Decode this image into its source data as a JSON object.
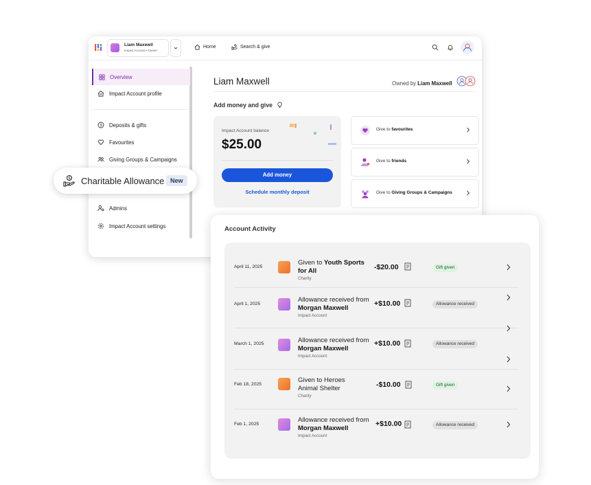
{
  "account": {
    "name": "Liam Maxwell",
    "subtitle": "Impact Account • Owner"
  },
  "nav": {
    "home": "Home",
    "search": "Search & give"
  },
  "sidebar": {
    "items": [
      {
        "label": "Overview",
        "icon": "grid-icon",
        "active": true
      },
      {
        "label": "Impact Account profile",
        "icon": "house-icon"
      },
      {
        "label": "Deposits & gifts",
        "icon": "dollar-circle-icon"
      },
      {
        "label": "Favourites",
        "icon": "heart-icon"
      },
      {
        "label": "Giving Groups & Campaigns",
        "icon": "people-icon"
      },
      {
        "label": "Admins",
        "icon": "person-gear-icon"
      },
      {
        "label": "Impact Account settings",
        "icon": "gear-icon"
      }
    ]
  },
  "main": {
    "title": "Liam Maxwell",
    "owned_prefix": "Owned by",
    "owned_name": "Liam Maxwell",
    "section_heading": "Add money and give",
    "balance_label": "Impact Account balance",
    "balance_value": "$25.00",
    "add_money": "Add money",
    "schedule": "Schedule monthly deposit",
    "give_prefix": "Give to",
    "give_favourites": "favourites",
    "give_friends": "friends",
    "give_groups": "Giving Groups & Campaigns"
  },
  "pill": {
    "label": "Charitable Allowance",
    "badge": "New"
  },
  "activity": {
    "title": "Account Activity",
    "rows": [
      {
        "date": "April 11, 2025",
        "desc_plain": "Given to",
        "desc_bold": "Youth Sports for All",
        "sub": "Charity",
        "amount": "-$20.00",
        "badge": "Gift given",
        "type": "gift"
      },
      {
        "date": "April 1, 2025",
        "desc_plain": "Allowance received from",
        "desc_bold": "Morgan Maxwell",
        "sub": "Impact Account",
        "amount": "+$10.00",
        "badge": "Allowance received",
        "type": "allowance"
      },
      {
        "date": "March 1, 2025",
        "desc_plain": "Allowance received from",
        "desc_bold": "Morgan Maxwell",
        "sub": "Impact Account",
        "amount": "+$10.00",
        "badge": "Allowance received",
        "type": "allowance"
      },
      {
        "date": "Feb 18, 2025",
        "desc_plain": "Given to Heroes Animal Shelter",
        "desc_bold": "",
        "sub": "Charity",
        "amount": "-$10.00",
        "badge": "Gift given",
        "type": "gift"
      },
      {
        "date": "Feb 1, 2025",
        "desc_plain": "Allowance received from",
        "desc_bold": "Morgan Maxwell",
        "sub": "Impact Account",
        "amount": "+$10.00",
        "badge": "Allowance received",
        "type": "allowance"
      }
    ]
  },
  "colors": {
    "accent": "#7b2aa0",
    "primary_button": "#1a56db",
    "gift_badge": "#dff3e2",
    "allowance_badge": "#e1e1e1"
  }
}
